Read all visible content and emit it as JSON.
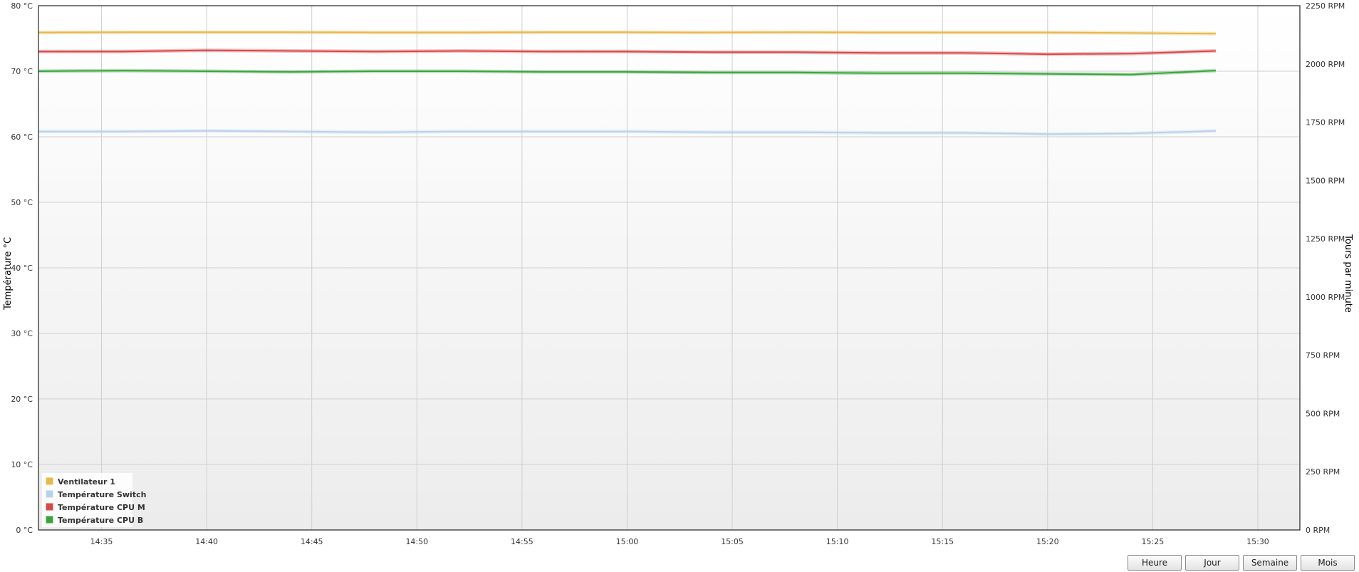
{
  "chart_data": {
    "type": "line",
    "y_left": {
      "label": "Température °C",
      "range": [
        0,
        80
      ],
      "ticks": [
        0,
        10,
        20,
        30,
        40,
        50,
        60,
        70,
        80
      ],
      "unit": "°C"
    },
    "y_right": {
      "label": "Tours par minute",
      "range": [
        0,
        2250
      ],
      "ticks": [
        0,
        250,
        500,
        750,
        1000,
        1250,
        1500,
        1750,
        2000,
        2250
      ],
      "unit": "RPM"
    },
    "x_ticks": [
      "14:35",
      "14:40",
      "14:45",
      "14:50",
      "14:55",
      "15:00",
      "15:05",
      "15:10",
      "15:15",
      "15:20",
      "15:25",
      "15:30"
    ],
    "x_range": [
      "14:32",
      "15:32"
    ],
    "grid": true,
    "legend_position": "bottom-left",
    "series": [
      {
        "name": "Ventilateur 1",
        "axis": "right",
        "color": "#e8b84a",
        "x": [
          "14:32",
          "14:36",
          "14:40",
          "14:44",
          "14:48",
          "14:52",
          "14:56",
          "15:00",
          "15:04",
          "15:08",
          "15:12",
          "15:16",
          "15:20",
          "15:24",
          "15:28"
        ],
        "values": [
          2135,
          2136,
          2136,
          2136,
          2135,
          2135,
          2136,
          2136,
          2135,
          2136,
          2135,
          2135,
          2135,
          2133,
          2130
        ]
      },
      {
        "name": "Température Switch",
        "axis": "left",
        "color": "#b7d3ec",
        "x": [
          "14:32",
          "14:36",
          "14:40",
          "14:44",
          "14:48",
          "14:52",
          "14:56",
          "15:00",
          "15:04",
          "15:08",
          "15:12",
          "15:16",
          "15:20",
          "15:24",
          "15:28"
        ],
        "values": [
          60.8,
          60.8,
          60.9,
          60.8,
          60.7,
          60.8,
          60.8,
          60.8,
          60.7,
          60.7,
          60.6,
          60.6,
          60.4,
          60.5,
          60.9
        ]
      },
      {
        "name": "Température CPU M",
        "axis": "left",
        "color": "#d9484a",
        "x": [
          "14:32",
          "14:36",
          "14:40",
          "14:44",
          "14:48",
          "14:52",
          "14:56",
          "15:00",
          "15:04",
          "15:08",
          "15:12",
          "15:16",
          "15:20",
          "15:24",
          "15:28"
        ],
        "values": [
          73.0,
          73.0,
          73.2,
          73.1,
          73.0,
          73.1,
          73.0,
          73.0,
          72.9,
          72.9,
          72.8,
          72.8,
          72.6,
          72.7,
          73.1
        ]
      },
      {
        "name": "Température CPU B",
        "axis": "left",
        "color": "#3aa53f",
        "x": [
          "14:32",
          "14:36",
          "14:40",
          "14:44",
          "14:48",
          "14:52",
          "14:56",
          "15:00",
          "15:04",
          "15:08",
          "15:12",
          "15:16",
          "15:20",
          "15:24",
          "15:28"
        ],
        "values": [
          70.0,
          70.1,
          70.0,
          69.9,
          70.0,
          70.0,
          69.9,
          69.9,
          69.8,
          69.8,
          69.7,
          69.7,
          69.6,
          69.5,
          70.1
        ]
      }
    ]
  },
  "range_buttons": [
    "Heure",
    "Jour",
    "Semaine",
    "Mois"
  ]
}
